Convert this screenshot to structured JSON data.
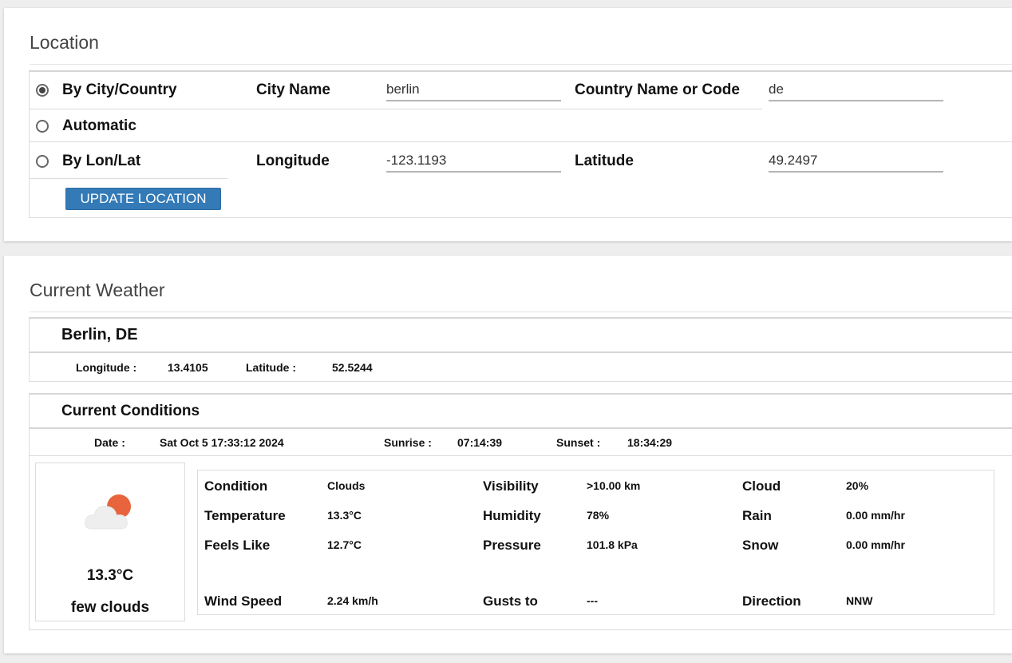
{
  "location": {
    "title": "Location",
    "options": {
      "by_city": "By City/Country",
      "automatic": "Automatic",
      "by_lonlat": "By Lon/Lat",
      "selected": "by_city"
    },
    "city_label": "City Name",
    "city_value": "berlin",
    "country_label": "Country Name or Code",
    "country_value": "de",
    "longitude_label": "Longitude",
    "longitude_value": "-123.1193",
    "latitude_label": "Latitude",
    "latitude_value": "49.2497",
    "update_button": "UPDATE LOCATION"
  },
  "weather": {
    "title": "Current Weather",
    "place": "Berlin, DE",
    "lon_label": "Longitude :",
    "lon_value": "13.4105",
    "lat_label": "Latitude :",
    "lat_value": "52.5244",
    "conditions_title": "Current Conditions",
    "date_label": "Date :",
    "date_value": "Sat Oct 5 17:33:12 2024",
    "sunrise_label": "Sunrise :",
    "sunrise_value": "07:14:39",
    "sunset_label": "Sunset :",
    "sunset_value": "18:34:29",
    "icon": "few-clouds-icon",
    "temp_big": "13.3°C",
    "description": "few clouds",
    "details": {
      "condition_label": "Condition",
      "condition_value": "Clouds",
      "temperature_label": "Temperature",
      "temperature_value": "13.3°C",
      "feels_like_label": "Feels Like",
      "feels_like_value": "12.7°C",
      "wind_speed_label": "Wind Speed",
      "wind_speed_value": "2.24 km/h",
      "visibility_label": "Visibility",
      "visibility_value": ">10.00 km",
      "humidity_label": "Humidity",
      "humidity_value": "78%",
      "pressure_label": "Pressure",
      "pressure_value": "101.8 kPa",
      "gusts_label": "Gusts to",
      "gusts_value": "---",
      "cloud_label": "Cloud",
      "cloud_value": "20%",
      "rain_label": "Rain",
      "rain_value": "0.00 mm/hr",
      "snow_label": "Snow",
      "snow_value": "0.00 mm/hr",
      "direction_label": "Direction",
      "direction_value": "NNW"
    }
  },
  "colors": {
    "button": "#337ab7",
    "sun": "#e8643c",
    "cloud": "#eeeeee"
  }
}
